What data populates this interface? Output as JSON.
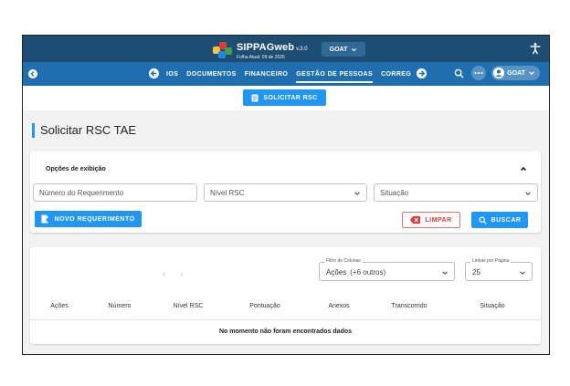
{
  "header": {
    "brand_main": "SIPPAG",
    "brand_web": "web",
    "version": "v.3.0",
    "subtitle": "Folha Atual: 09 de 2025",
    "org_selector": "GOAT",
    "colors": {
      "topbar": "#1e4d73",
      "navbar": "#1f6fb0",
      "accent": "#2196f3",
      "danger": "#e53935"
    }
  },
  "nav": {
    "items": [
      {
        "label": "IOS",
        "active": false
      },
      {
        "label": "DOCUMENTOS",
        "active": false
      },
      {
        "label": "FINANCEIRO",
        "active": false
      },
      {
        "label": "GESTÃO DE PESSOAS",
        "active": true
      },
      {
        "label": "CORREG",
        "active": false
      }
    ],
    "user_label": "GOAT"
  },
  "actionbar": {
    "solicitar_label": "SOLICITAR RSC"
  },
  "page": {
    "title": "Solicitar RSC TAE"
  },
  "filters": {
    "heading": "Opções de exibição",
    "numero_placeholder": "Número do Requerimento",
    "nivel_placeholder": "Nível RSC",
    "situacao_placeholder": "Situação",
    "novo_label": "NOVO REQUERIMENTO",
    "limpar_label": "LIMPAR",
    "buscar_label": "BUSCAR"
  },
  "table": {
    "prev_symbol": "‹",
    "next_symbol": "›",
    "column_filter_legend": "Filtro de Colunas",
    "column_filter_value": "Ações",
    "column_filter_extra": "(+6 outros)",
    "rows_per_page_legend": "Linhas por Página",
    "rows_per_page_value": "25",
    "columns": [
      "Ações",
      "Número",
      "Nível RSC",
      "Pontuação",
      "Anexos",
      "Transcorrido",
      "Situação"
    ],
    "empty_message": "No momento não foram encontrados dados"
  }
}
